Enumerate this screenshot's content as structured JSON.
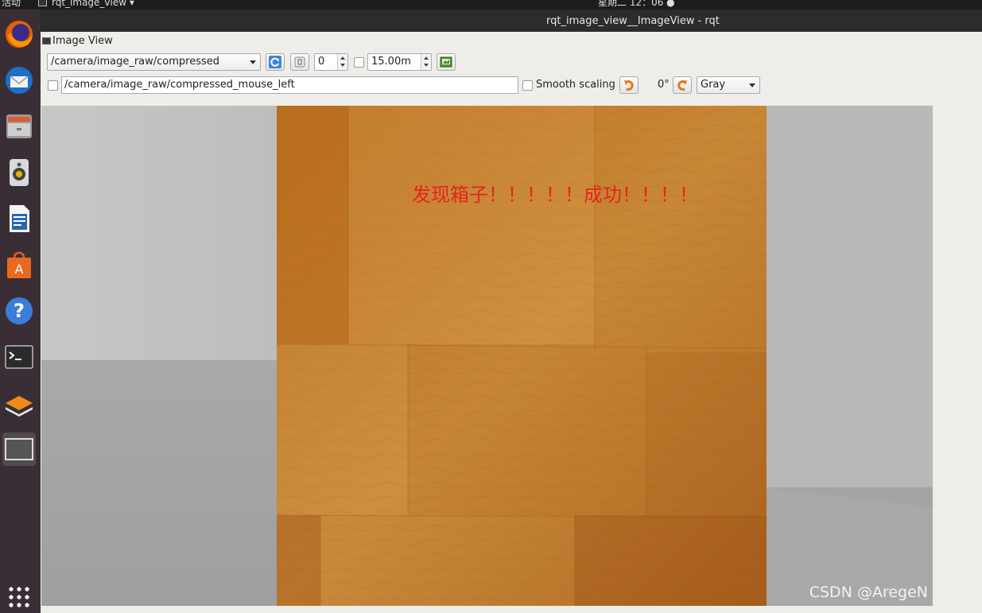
{
  "topbar": {
    "activities": "活动",
    "app_menu": "rqt_image_view ▾",
    "clock": "星期二 12：06 ●"
  },
  "window": {
    "title": "rqt_image_view__ImageView - rqt",
    "panel_title": "Image View"
  },
  "toolbar": {
    "topic": "/camera/image_raw/compressed",
    "spin_value": "0",
    "spin_distance": "15.00m",
    "mouse_topic": "/camera/image_raw/compressed_mouse_left",
    "smooth_scaling_label": "Smooth scaling",
    "smooth_scaling_checked": false,
    "rotation": "0°",
    "color_scheme": "Gray"
  },
  "image": {
    "overlay_text": "发现箱子！！！！！成功！！！！"
  },
  "watermark": "CSDN @AregeN",
  "dock": [
    {
      "name": "firefox-icon"
    },
    {
      "name": "thunderbird-icon"
    },
    {
      "name": "files-icon"
    },
    {
      "name": "rhythmbox-icon"
    },
    {
      "name": "libreoffice-writer-icon"
    },
    {
      "name": "software-center-icon"
    },
    {
      "name": "help-icon"
    },
    {
      "name": "terminal-icon"
    },
    {
      "name": "layers-icon"
    },
    {
      "name": "window-icon"
    },
    {
      "name": "show-apps-icon"
    }
  ]
}
